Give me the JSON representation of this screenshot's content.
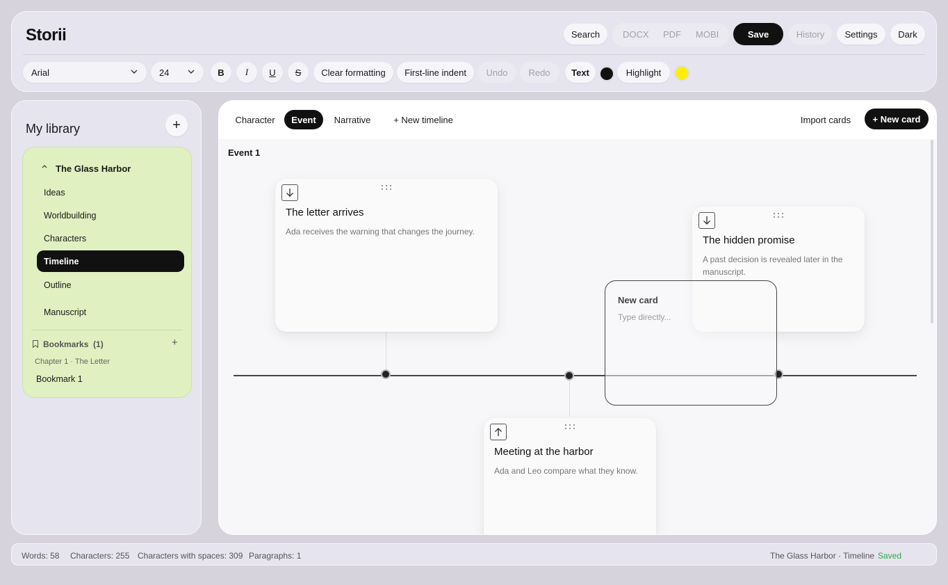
{
  "header": {
    "brand": "Storii",
    "search_label": "Search",
    "export": [
      "DOCX",
      "PDF",
      "MOBI"
    ],
    "save_label": "Save",
    "history_label": "History",
    "settings_label": "Settings",
    "theme_label": "Dark"
  },
  "toolbar": {
    "font_family": "Arial",
    "font_size": "24",
    "bold": "B",
    "italic": "I",
    "underline": "U",
    "strike": "S",
    "clear_formatting": "Clear formatting",
    "first_line_indent": "First-line indent",
    "undo": "Undo",
    "redo": "Redo",
    "text_label": "Text",
    "text_color": "#111111",
    "highlight_label": "Highlight",
    "highlight_color": "#ffee00"
  },
  "sidebar": {
    "title": "My library",
    "add_label": "+",
    "project": {
      "name": "The Glass Harbor",
      "items": [
        "Ideas",
        "Worldbuilding",
        "Characters",
        "Timeline",
        "Outline",
        "Manuscript"
      ],
      "active_item": "Timeline"
    },
    "bookmarks": {
      "label": "Bookmarks",
      "count": "(1)",
      "add_label": "+",
      "chapter": "Chapter 1 · The Letter",
      "item": "Bookmark 1"
    }
  },
  "main": {
    "tabs": [
      "Character",
      "Event",
      "Narrative",
      "+ New timeline"
    ],
    "active_tab": "Event",
    "import_label": "Import cards",
    "new_card_label": "+ New card",
    "section_label": "Event 1",
    "cards": [
      {
        "title": "The letter arrives",
        "description": "Ada receives the warning that changes the journey.",
        "arrow": "down"
      },
      {
        "title": "The hidden promise",
        "description": "A past decision is revealed later in the manuscript.",
        "arrow": "down"
      },
      {
        "title": "Meeting at the harbor",
        "description": "Ada and Leo compare what they know.",
        "arrow": "up"
      }
    ],
    "draft_card": {
      "title": "New card",
      "placeholder": "Type directly..."
    }
  },
  "status": {
    "words": "Words: 58",
    "characters": "Characters: 255",
    "characters_spaces": "Characters with spaces: 309",
    "paragraphs": "Paragraphs: 1",
    "location": "The Glass Harbor · Timeline",
    "save_state": "Saved"
  }
}
